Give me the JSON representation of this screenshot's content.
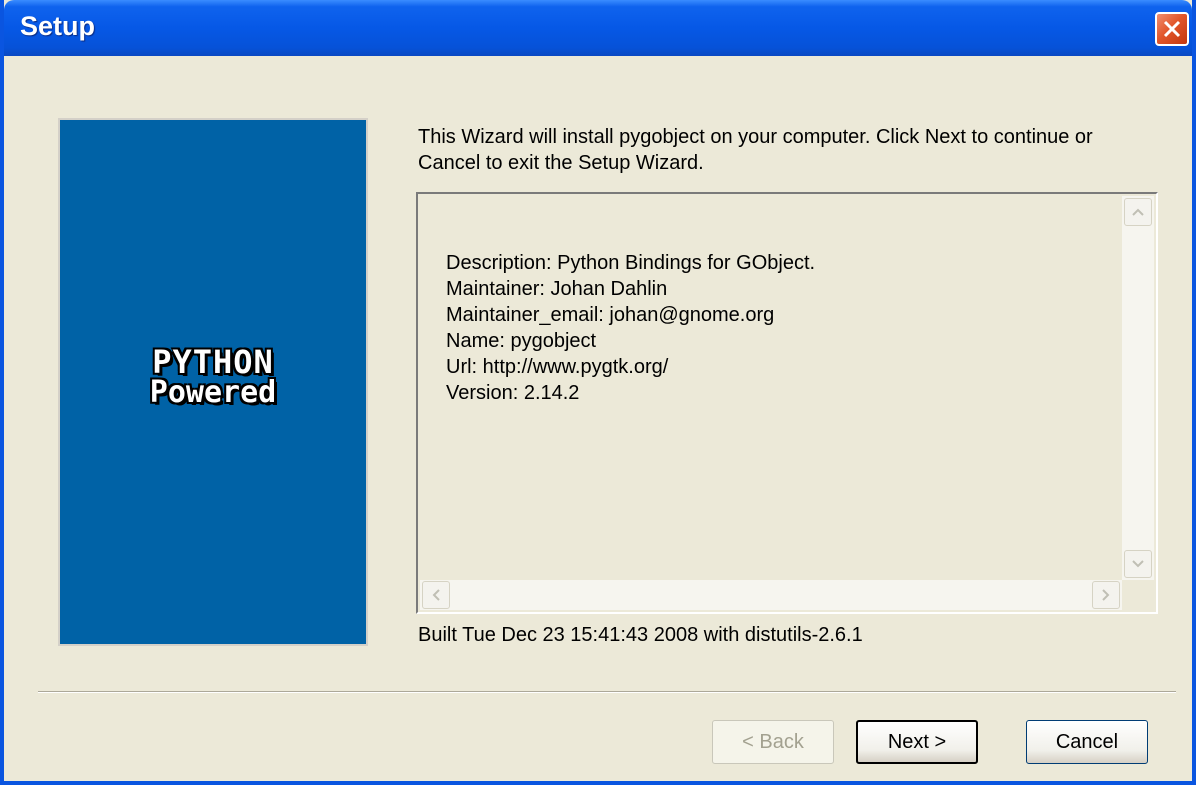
{
  "window": {
    "title": "Setup"
  },
  "banner": {
    "logo_line1": "PYTHON",
    "logo_line2": "Powered"
  },
  "intro_text": "This Wizard will install pygobject on your computer. Click Next to continue or Cancel to exit the Setup Wizard.",
  "details": [
    "Description: Python Bindings for GObject.",
    "Maintainer: Johan Dahlin",
    "Maintainer_email: johan@gnome.org",
    "Name: pygobject",
    "Url: http://www.pygtk.org/",
    "Version: 2.14.2"
  ],
  "build_info": "Built Tue Dec 23 15:41:43 2008 with distutils-2.6.1",
  "buttons": {
    "back": "< Back",
    "next": "Next >",
    "cancel": "Cancel"
  },
  "icons": {
    "close": "close-icon",
    "scroll_up": "chevron-up-icon",
    "scroll_down": "chevron-down-icon",
    "scroll_left": "chevron-left-icon",
    "scroll_right": "chevron-right-icon"
  },
  "colors": {
    "titlebar": "#0658e6",
    "banner": "#0062a6",
    "close_button": "#e2572b",
    "dialog_bg": "#ece9d8"
  }
}
